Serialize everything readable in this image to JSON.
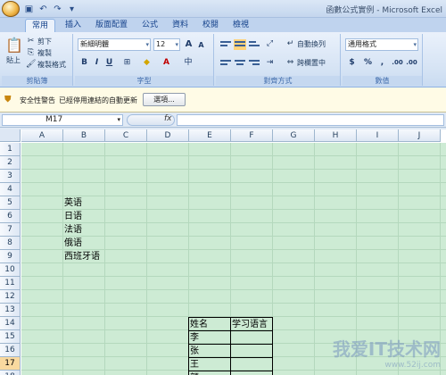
{
  "window": {
    "title": "函數公式實例 - Microsoft Excel",
    "qat_icons": [
      "save-icon",
      "undo-icon",
      "redo-icon",
      "dropdown-icon"
    ]
  },
  "tabs": [
    {
      "label": "常用",
      "active": true
    },
    {
      "label": "插入"
    },
    {
      "label": "版面配置"
    },
    {
      "label": "公式"
    },
    {
      "label": "資料"
    },
    {
      "label": "校閱"
    },
    {
      "label": "檢視"
    }
  ],
  "ribbon": {
    "clipboard": {
      "paste": "貼上",
      "cut": "剪下",
      "copy": "複製",
      "format_painter": "複製格式",
      "label": "剪貼簿"
    },
    "font": {
      "name": "新細明體",
      "size": "12",
      "label": "字型",
      "bold": "B",
      "italic": "I",
      "underline": "U",
      "grow": "A",
      "shrink": "A",
      "phonetic": "中"
    },
    "alignment": {
      "wrap": "自動換列",
      "merge": "跨欄置中",
      "label": "對齊方式"
    },
    "number": {
      "format": "通用格式",
      "currency": "$",
      "percent": "%",
      "comma": ",",
      "inc_decimal": ".00",
      "dec_decimal": ".00",
      "label": "數值"
    }
  },
  "security_bar": {
    "title": "安全性警告",
    "message": "已經停用連結的自動更新",
    "options_button": "選項..."
  },
  "formula_bar": {
    "name_box": "M17",
    "fx": "fx",
    "value": ""
  },
  "sheet": {
    "columns": [
      "A",
      "B",
      "C",
      "D",
      "E",
      "F",
      "G",
      "H",
      "I",
      "J"
    ],
    "rows": [
      "1",
      "2",
      "3",
      "4",
      "5",
      "6",
      "7",
      "8",
      "9",
      "10",
      "11",
      "12",
      "13",
      "14",
      "15",
      "16",
      "17",
      "18"
    ],
    "selected_row": "17",
    "languages": [
      "英语",
      "日语",
      "法语",
      "俄语",
      "西班牙语"
    ],
    "table": {
      "headers": [
        "姓名",
        "学习语言"
      ],
      "rows": [
        [
          "李",
          ""
        ],
        [
          "张",
          ""
        ],
        [
          "王",
          ""
        ],
        [
          "颜",
          ""
        ]
      ]
    }
  },
  "watermark": {
    "main": "我爱IT技术网",
    "sub": "www.52ij.com"
  }
}
